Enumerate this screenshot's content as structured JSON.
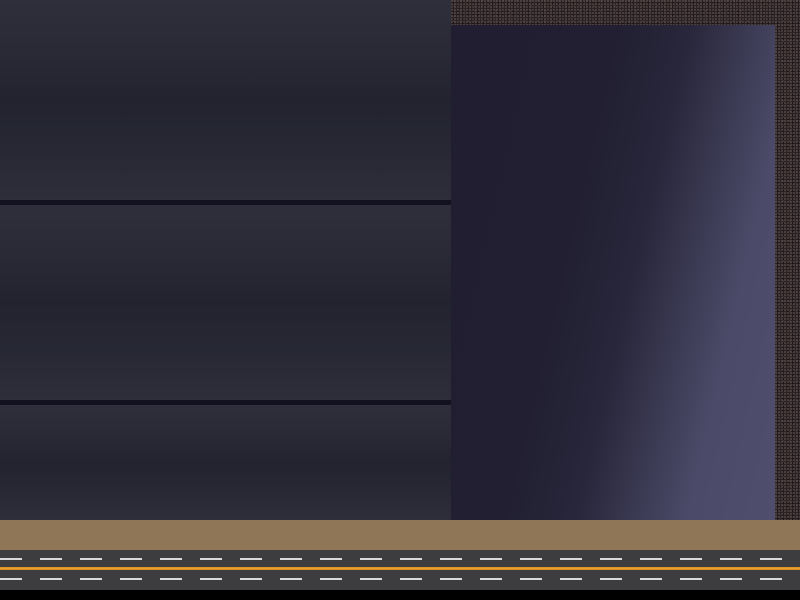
{
  "scene": {
    "colors": {
      "wall": "#292a35",
      "wall_seam": "#12111f",
      "door_dark": "#201e30",
      "door_light": "#4f4e6d",
      "backdrop": "#2b2224",
      "ground": "#8f7656",
      "road": "#3d3c3f",
      "lane_marking": "#d9d9d9",
      "center_line": "#f0a83a"
    }
  }
}
